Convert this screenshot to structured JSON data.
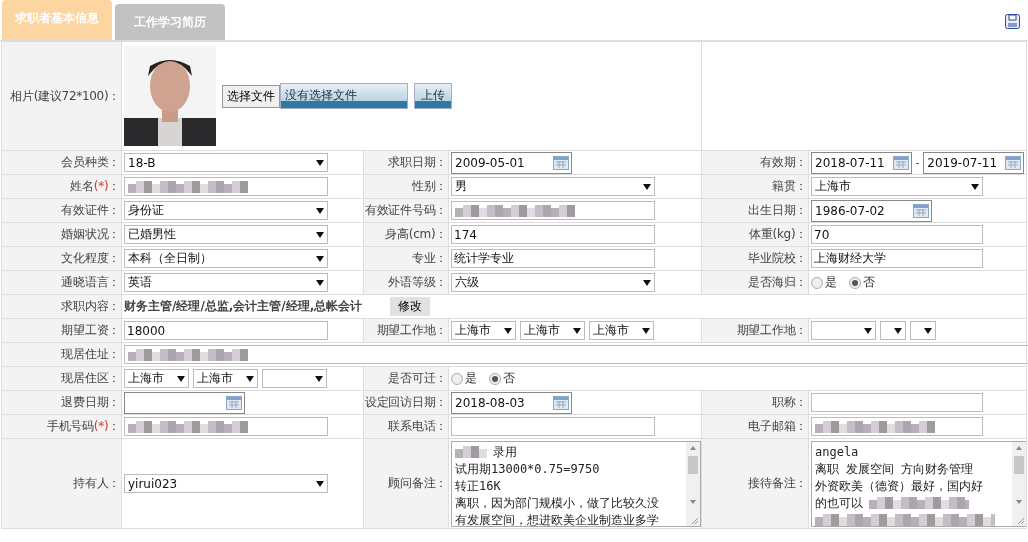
{
  "tabs": [
    {
      "label": "求职者基本信息",
      "selected": true
    },
    {
      "label": "工作学习简历",
      "selected": false
    }
  ],
  "rows": [
    {
      "pairs": [
        {
          "label": "相片(建议72*100)：",
          "field": {
            "choose_button": "选择文件",
            "file_status": "没有选择文件",
            "upload_button": "上传"
          }
        }
      ]
    },
    {
      "pairs": [
        {
          "label": "会员种类：",
          "field": {
            "kind": "select",
            "value": "18-B"
          }
        },
        {
          "label": "求职日期：",
          "field": {
            "kind": "date",
            "value": "2009-05-01"
          }
        },
        {
          "label": "有效期：",
          "field": {
            "kind": "date_range",
            "from": "2018-07-11",
            "separator": "-",
            "to": "2019-07-11"
          }
        }
      ]
    },
    {
      "pairs": [
        {
          "label": "姓名",
          "required_mark": "(*)",
          "colon": "：",
          "field": {
            "kind": "text",
            "redacted": true
          }
        },
        {
          "label": "性别：",
          "field": {
            "kind": "select",
            "value": "男"
          }
        },
        {
          "label": "籍贯：",
          "field": {
            "kind": "select",
            "value": "上海市"
          }
        }
      ]
    },
    {
      "pairs": [
        {
          "label": "有效证件：",
          "field": {
            "kind": "select",
            "value": "身份证"
          }
        },
        {
          "label": "有效证件号码：",
          "field": {
            "kind": "text",
            "redacted": true
          }
        },
        {
          "label": "出生日期：",
          "field": {
            "kind": "date",
            "value": "1986-07-02"
          }
        }
      ]
    },
    {
      "pairs": [
        {
          "label": "婚姻状况：",
          "field": {
            "kind": "select",
            "value": "已婚男性"
          }
        },
        {
          "label": "身高(cm)：",
          "field": {
            "kind": "text",
            "value": "174"
          }
        },
        {
          "label": "体重(kg)：",
          "field": {
            "kind": "text",
            "value": "70"
          }
        }
      ]
    },
    {
      "pairs": [
        {
          "label": "文化程度：",
          "field": {
            "kind": "select",
            "value": "本科（全日制）"
          }
        },
        {
          "label": "专业：",
          "field": {
            "kind": "text",
            "value": "统计学专业"
          }
        },
        {
          "label": "毕业院校：",
          "field": {
            "kind": "text",
            "value": "上海财经大学"
          }
        }
      ]
    },
    {
      "pairs": [
        {
          "label": "通晓语言：",
          "field": {
            "kind": "select",
            "value": "英语"
          }
        },
        {
          "label": "外语等级：",
          "field": {
            "kind": "select",
            "value": "六级"
          }
        },
        {
          "label": "是否海归：",
          "field": {
            "kind": "radio",
            "options": [
              {
                "label": "是",
                "selected": false
              },
              {
                "label": "否",
                "selected": true
              }
            ]
          }
        }
      ]
    },
    {
      "pairs": [
        {
          "label": "求职内容：",
          "field": {
            "kind": "job_content",
            "text": "财务主管/经理/总监,会计主管/经理,总帐会计",
            "button": "修改"
          }
        }
      ]
    },
    {
      "pairs": [
        {
          "label": "期望工资：",
          "field": {
            "kind": "text",
            "value": "18000"
          }
        },
        {
          "label": "期望工作地：",
          "field": {
            "kind": "selects",
            "items": [
              {
                "kind": "select",
                "value": "上海市"
              },
              {
                "kind": "select",
                "value": "上海市"
              },
              {
                "kind": "select",
                "value": "上海市"
              }
            ]
          }
        },
        {
          "label": "期望工作地：",
          "field": {
            "kind": "selects",
            "items": [
              {
                "kind": "select"
              },
              {
                "kind": "select"
              },
              {
                "kind": "select"
              }
            ]
          }
        }
      ]
    },
    {
      "pairs": [
        {
          "label": "现居住址：",
          "field": {
            "kind": "text",
            "redacted": true
          }
        }
      ]
    },
    {
      "pairs": [
        {
          "label": "现居住区：",
          "field": {
            "kind": "selects",
            "items": [
              {
                "kind": "select",
                "value": "上海市"
              },
              {
                "kind": "select",
                "value": "上海市"
              },
              {
                "kind": "select"
              }
            ]
          }
        },
        {
          "label": "是否可迁：",
          "field": {
            "kind": "radio",
            "options": [
              {
                "label": "是",
                "selected": false
              },
              {
                "label": "否",
                "selected": true
              }
            ]
          }
        }
      ]
    },
    {
      "pairs": [
        {
          "label": "退费日期：",
          "field": {
            "kind": "date"
          }
        },
        {
          "label": "设定回访日期：",
          "field": {
            "kind": "date",
            "value": "2018-08-03"
          }
        },
        {
          "label": "职称：",
          "field": {
            "kind": "text"
          }
        }
      ]
    },
    {
      "pairs": [
        {
          "label": "手机号码",
          "required_mark": "(*)",
          "colon": "：",
          "field": {
            "kind": "text",
            "redacted": true
          }
        },
        {
          "label": "联系电话：",
          "field": {
            "kind": "text"
          }
        },
        {
          "label": "电子邮箱：",
          "field": {
            "kind": "text",
            "redacted": true
          }
        }
      ]
    },
    {
      "pairs": [
        {
          "label": "持有人：",
          "field": {
            "kind": "select",
            "value": "yirui023"
          }
        },
        {
          "label": "顾问备注：",
          "field": {
            "kind": "textarea",
            "lines": [
              {
                "redacted": true,
                "text": "录用"
              },
              {
                "redacted": false,
                "text": "试用期13000*0.75=9750"
              },
              {
                "redacted": false,
                "text": "转正16K"
              },
              {
                "redacted": false,
                "text": "离职，因为部门规模小，做了比较久没"
              },
              {
                "redacted": false,
                "text": "有发展空间，想进欧美企业制造业多学"
              }
            ]
          }
        },
        {
          "label": "接待备注：",
          "field": {
            "kind": "textarea",
            "lines": [
              {
                "redacted": false,
                "text": "angela"
              },
              {
                "redacted": false,
                "text": "离职 发展空间 方向财务管理"
              },
              {
                "redacted": false,
                "text": "外资欧美（德资）最好，国内好"
              },
              {
                "redacted": false,
                "text": "的也可以",
                "trailing_redacted": true
              },
              {
                "redacted": true
              }
            ]
          }
        }
      ]
    }
  ]
}
